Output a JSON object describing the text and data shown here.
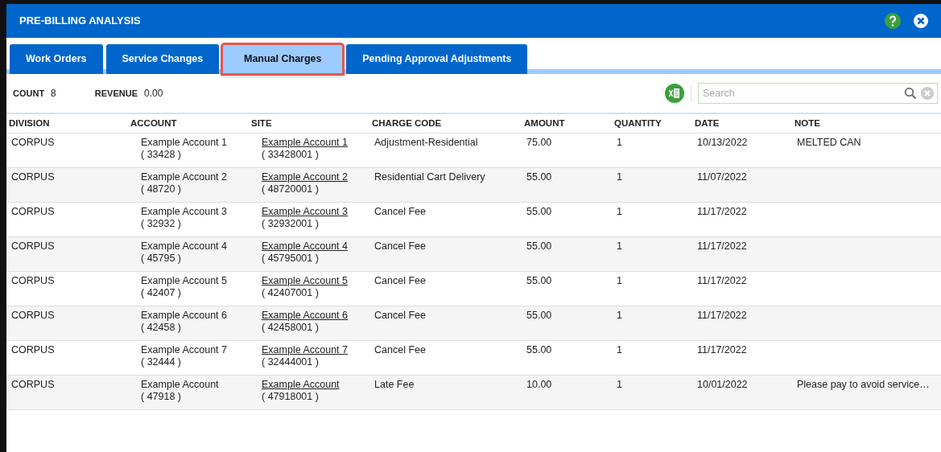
{
  "window": {
    "title": "PRE-BILLING ANALYSIS"
  },
  "tabs": [
    {
      "label": "Work Orders",
      "selected": false
    },
    {
      "label": "Service Changes",
      "selected": false
    },
    {
      "label": "Manual Charges",
      "selected": true
    },
    {
      "label": "Pending Approval Adjustments",
      "selected": false
    }
  ],
  "summary": [
    {
      "label": "COUNT",
      "value": "8"
    },
    {
      "label": "REVENUE",
      "value": "0.00"
    }
  ],
  "search": {
    "placeholder": "Search"
  },
  "table": {
    "columns": [
      "DIVISION",
      "ACCOUNT",
      "SITE",
      "CHARGE CODE",
      "AMOUNT",
      "QUANTITY",
      "DATE",
      "NOTE"
    ],
    "rows": [
      {
        "division": "CORPUS",
        "account": "Example Account 1",
        "account_id": "( 33428 )",
        "site": "Example Account 1",
        "site_id": "( 33428001 )",
        "charge_code": "Adjustment-Residential",
        "amount": "75.00",
        "quantity": "1",
        "date": "10/13/2022",
        "note": "MELTED CAN"
      },
      {
        "division": "CORPUS",
        "account": "Example Account 2",
        "account_id": "( 48720 )",
        "site": "Example Account 2",
        "site_id": "( 48720001 )",
        "charge_code": "Residential Cart Delivery",
        "amount": "55.00",
        "quantity": "1",
        "date": "11/07/2022"
      },
      {
        "division": "CORPUS",
        "account": "Example Account 3",
        "account_id": "( 32932 )",
        "site": "Example Account 3",
        "site_id": "( 32932001 )",
        "charge_code": "Cancel Fee",
        "amount": "55.00",
        "quantity": "1",
        "date": "11/17/2022"
      },
      {
        "division": "CORPUS",
        "account": "Example Account 4",
        "account_id": "( 45795 )",
        "site": "Example Account 4",
        "site_id": "( 45795001 )",
        "charge_code": "Cancel Fee",
        "amount": "55.00",
        "quantity": "1",
        "date": "11/17/2022"
      },
      {
        "division": "CORPUS",
        "account": "Example Account 5",
        "account_id": "( 42407 )",
        "site": "Example Account 5",
        "site_id": "( 42407001 )",
        "charge_code": "Cancel Fee",
        "amount": "55.00",
        "quantity": "1",
        "date": "11/17/2022"
      },
      {
        "division": "CORPUS",
        "account": "Example Account 6",
        "account_id": "( 42458 )",
        "site": "Example Account 6",
        "site_id": "( 42458001 )",
        "charge_code": "Cancel Fee",
        "amount": "55.00",
        "quantity": "1",
        "date": "11/17/2022"
      },
      {
        "division": "CORPUS",
        "account": "Example Account 7",
        "account_id": "( 32444 )",
        "site": "Example Account 7",
        "site_id": "( 32444001 )",
        "charge_code": "Cancel Fee",
        "amount": "55.00",
        "quantity": "1",
        "date": "11/17/2022"
      },
      {
        "division": "CORPUS",
        "account": "Example Account",
        "account_id": "( 47918 )",
        "site": "Example Account",
        "site_id": "( 47918001 )",
        "charge_code": "Late Fee",
        "amount": "10.00",
        "quantity": "1",
        "date": "10/01/2022",
        "note": "Please pay to avoid service…"
      }
    ]
  }
}
